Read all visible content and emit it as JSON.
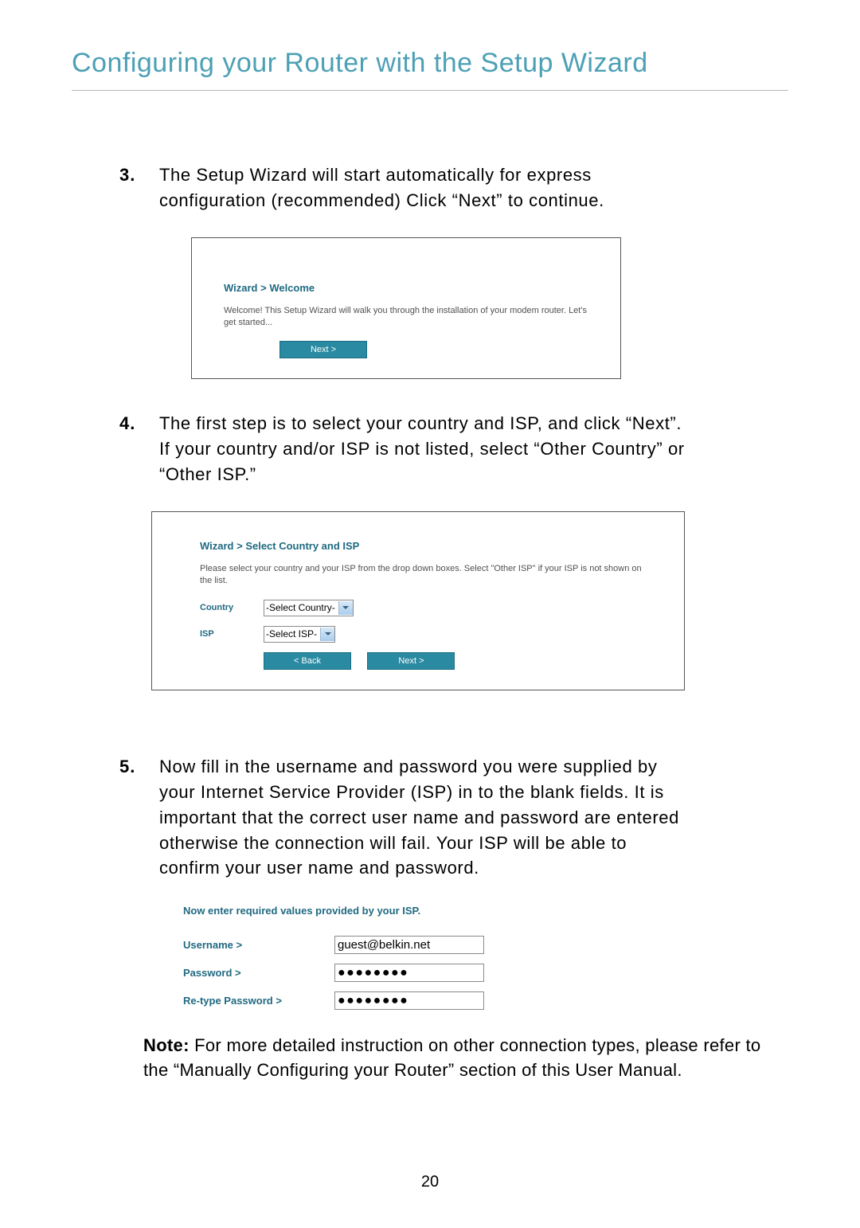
{
  "page": {
    "title": "Configuring your Router with the Setup Wizard",
    "number": "20"
  },
  "steps": {
    "s3": {
      "num": "3.",
      "text": "The Setup Wizard will start automatically for express configuration (recommended) Click “Next” to continue."
    },
    "s4": {
      "num": "4.",
      "text": "The first step is to select your country and ISP, and click “Next”. If your country and/or ISP is not listed, select “Other Country” or “Other ISP.”"
    },
    "s5": {
      "num": "5.",
      "text": "Now fill in the username and password you were supplied by your Internet Service Provider (ISP) in to the blank fields. It is important that the correct user name and password are entered otherwise the connection will fail. Your ISP will be able to confirm your user name and password."
    }
  },
  "shot1": {
    "title": "Wizard > Welcome",
    "desc": "Welcome! This Setup Wizard will walk you through the installation of your modem router. Let's get started...",
    "next": "Next >"
  },
  "shot2": {
    "title": "Wizard > Select Country and ISP",
    "desc": "Please select your country and your ISP from the drop down boxes. Select \"Other ISP\" if your ISP is not shown on the list.",
    "country_label": "Country",
    "isp_label": "ISP",
    "country_value": "-Select Country-",
    "isp_value": "-Select ISP-",
    "back": "< Back",
    "next": "Next >"
  },
  "panel3": {
    "title": "Now enter required values provided by your ISP.",
    "username_label": "Username >",
    "password_label": "Password >",
    "retype_label": "Re-type Password >",
    "username_value": "guest@belkin.net",
    "password_value": "●●●●●●●●",
    "retype_value": "●●●●●●●●"
  },
  "note": {
    "bold": "Note:",
    "text": " For more detailed instruction on other connection types, please refer to the “Manually Configuring your Router” section of this User Manual."
  }
}
